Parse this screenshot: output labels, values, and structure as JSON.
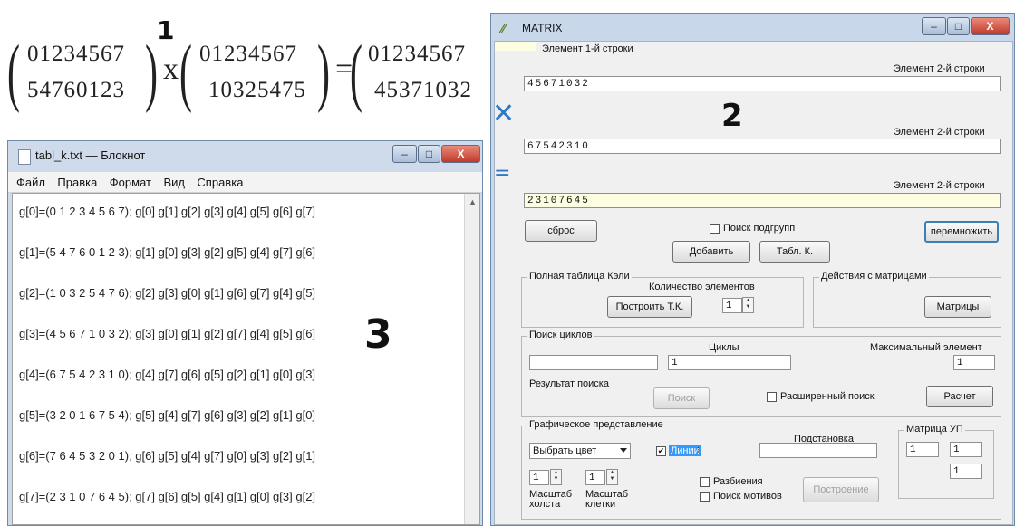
{
  "labels": {
    "one": "1",
    "two": "2",
    "three": "3"
  },
  "formula": {
    "left_top": "01234567",
    "left_bottom": "54760123",
    "times": "x",
    "right_top": "01234567",
    "right_bottom": "10325475",
    "equals": "=",
    "result_top": "01234567",
    "result_bottom": "45371032"
  },
  "notepad": {
    "title": "tabl_k.txt — Блокнот",
    "menu": [
      "Файл",
      "Правка",
      "Формат",
      "Вид",
      "Справка"
    ],
    "lines": [
      "g[0]=(0 1 2 3 4 5 6 7);  g[0]  g[1]  g[2]  g[3]  g[4]  g[5]  g[6]  g[7]",
      "g[1]=(5 4 7 6 0 1 2 3);  g[1]  g[0]  g[3]  g[2]  g[5]  g[4]  g[7]  g[6]",
      "g[2]=(1 0 3 2 5 4 7 6);  g[2]  g[3]  g[0]  g[1]  g[6]  g[7]  g[4]  g[5]",
      "g[3]=(4 5 6 7 1 0 3 2);  g[3]  g[0]  g[1]  g[2]  g[7]  g[4]  g[5]  g[6]",
      "g[4]=(6 7 5 4 2 3 1 0);  g[4]  g[7]  g[6]  g[5]  g[2]  g[1]  g[0]  g[3]",
      "g[5]=(3 2 0 1 6 7 5 4);  g[5]  g[4]  g[7]  g[6]  g[3]  g[2]  g[1]  g[0]",
      "g[6]=(7 6 4 5 3 2 0 1);  g[6]  g[5]  g[4]  g[7]  g[0]  g[3]  g[2]  g[1]",
      "g[7]=(2 3 1 0 7 6 4 5);  g[7]  g[6]  g[5]  g[4]  g[1]  g[0]  g[3]  g[2]"
    ]
  },
  "matrix": {
    "title": "MATRIX",
    "row1_label": "Элемент 1-й строки",
    "row2_label": "Элемент 2-й строки",
    "field1": "45671032",
    "times_sym": "✕",
    "field2": "67542310",
    "equals_sym": "=",
    "field3": "23107645",
    "reset": "сброс",
    "subgroup_search": "Поиск подгрупп",
    "multiply": "перемножить",
    "add": "Добавить",
    "table_k": "Табл. К.",
    "cayley_group": "Полная таблица Кэли",
    "element_count": "Количество элементов",
    "build_tk": "Построить Т.К.",
    "count_value": "1",
    "matrix_actions": "Действия с матрицами",
    "matrices": "Матрицы",
    "cycle_search": "Поиск циклов",
    "cycles": "Циклы",
    "cycles_value": "1",
    "max_element": "Максимальный элемент",
    "max_value": "1",
    "search_result": "Результат поиска",
    "search": "Поиск",
    "extended_search": "Расширенный поиск",
    "calc": "Расчет",
    "graphic": "Графическое представление",
    "choose_color": "Выбрать цвет",
    "lines_cb": "Линии",
    "substitution": "Подстановка",
    "matrix_up": "Матрица УП",
    "up1": "1",
    "up2": "1",
    "up3": "1",
    "scale1": "1",
    "scale2": "1",
    "canvas_scale": "Масштаб холста",
    "cell_scale": "Масштаб клетки",
    "partitions": "Разбиения",
    "motif_search": "Поиск мотивов",
    "build": "Построение"
  },
  "window_controls": {
    "min": "–",
    "max": "□",
    "close": "X"
  }
}
